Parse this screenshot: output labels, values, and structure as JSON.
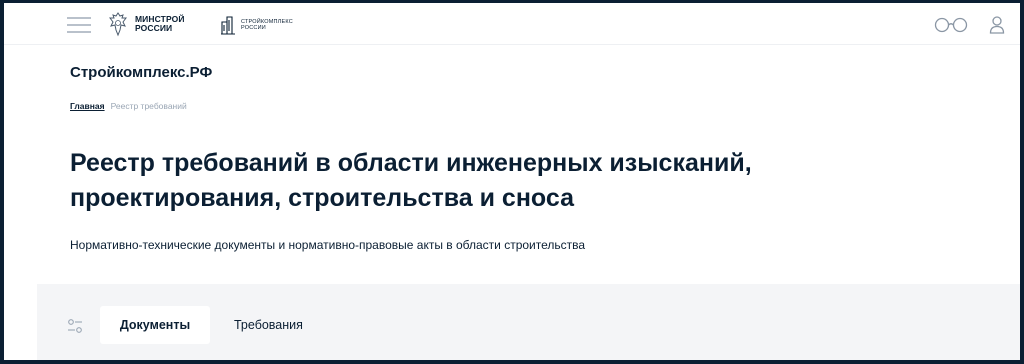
{
  "header": {
    "menu_icon": "hamburger-menu-icon",
    "minstroy_logo": {
      "line1": "МИНСТРОЙ",
      "line2": "РОССИИ",
      "emblem": "eagle-emblem-icon"
    },
    "stroycomplex_logo": {
      "line1": "СТРОЙКОМПЛЕКС",
      "line2": "РОССИИ",
      "mark": "building-logo-icon"
    },
    "accessibility_icon": "glasses-icon",
    "user_icon": "user-icon"
  },
  "site_title": "Стройкомплекс.РФ",
  "breadcrumb": {
    "home": "Главная",
    "current": "Реестр требований"
  },
  "page": {
    "title": "Реестр требований в области инженерных изысканий, проектирования, строительства и сноса",
    "subtitle": "Нормативно-технические документы и нормативно-правовые акты в области строительства"
  },
  "tabs": [
    {
      "label": "Документы",
      "active": true
    },
    {
      "label": "Требования",
      "active": false
    }
  ],
  "filter_icon": "filter-sliders-icon",
  "colors": {
    "text": "#0b1f33",
    "muted": "#9aa6b4",
    "panel_bg": "#f4f5f7",
    "border": "#0b1f33"
  }
}
